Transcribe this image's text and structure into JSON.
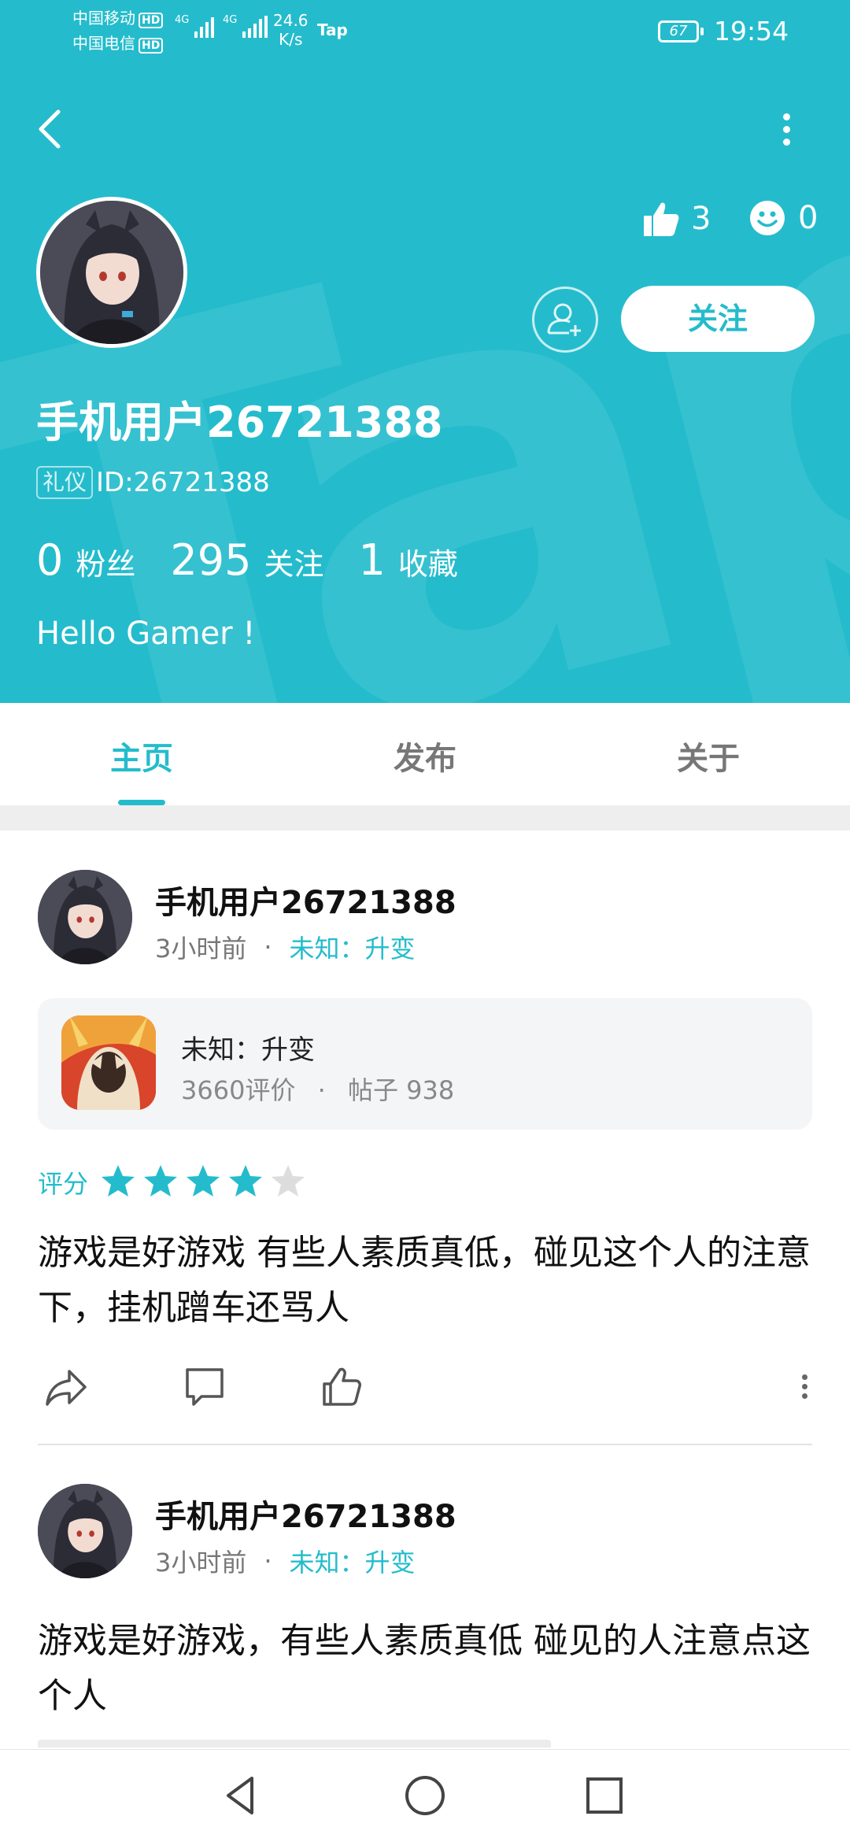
{
  "status_bar": {
    "carrier1": "中国移动",
    "carrier2": "中国电信",
    "hd": "HD",
    "net1": "4G",
    "net2": "4G",
    "speed_value": "24.6",
    "speed_unit": "K/s",
    "app_badge": "Tap",
    "battery": "67",
    "time": "19:54"
  },
  "profile": {
    "likes_count": "3",
    "smiles_count": "0",
    "follow_label": "关注",
    "username": "手机用户26721388",
    "badge": "礼仪",
    "id_text": "ID:26721388",
    "stats": [
      {
        "value": "0",
        "label": "粉丝"
      },
      {
        "value": "295",
        "label": "关注"
      },
      {
        "value": "1",
        "label": "收藏"
      }
    ],
    "bio": "Hello Gamer !"
  },
  "tabs": [
    {
      "label": "主页",
      "active": true
    },
    {
      "label": "发布",
      "active": false
    },
    {
      "label": "关于",
      "active": false
    }
  ],
  "posts": [
    {
      "author": "手机用户26721388",
      "time": "3小时前",
      "separator": "·",
      "game_ref": "未知：升变",
      "game_card": {
        "name": "未知：升变",
        "reviews": "3660评价",
        "separator": "·",
        "posts": "帖子 938"
      },
      "rating_label": "评分",
      "rating": 4,
      "rating_max": 5,
      "text": "游戏是好游戏 有些人素质真低，碰见这个人的注意下，挂机蹭车还骂人"
    },
    {
      "author": "手机用户26721388",
      "time": "3小时前",
      "separator": "·",
      "game_ref": "未知：升变",
      "text": "游戏是好游戏，有些人素质真低 碰见的人注意点这个人"
    }
  ],
  "colors": {
    "accent": "#24bccc",
    "star_empty": "#dddddd"
  },
  "icons": [
    "back-icon",
    "more-icon",
    "thumbs-up-icon",
    "smile-icon",
    "add-friend-icon",
    "share-icon",
    "comment-icon",
    "like-icon",
    "nav-back-icon",
    "nav-home-icon",
    "nav-recents-icon"
  ]
}
